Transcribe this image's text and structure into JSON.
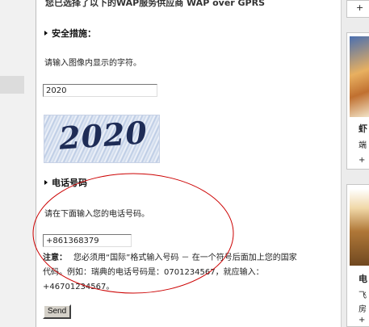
{
  "top_notice": "您已选择了以下的WAP服务供应商 WAP over GPRS",
  "security": {
    "title": "安全措施：",
    "instruction": "请输入图像内显示的字符。",
    "input_value": "2020",
    "captcha_text": "2020"
  },
  "phone": {
    "title": "电话号码",
    "instruction": "请在下面输入您的电话号码。",
    "input_value": "+861368379",
    "note_label": "注意：",
    "note_line1": "您必须用“国际”格式输入号码 － 在一个符号后面加上您的国家",
    "note_line2": "代码。例如：瑞典的电话号码是：0701234567，就应输入：",
    "note_line3": "+46701234567。"
  },
  "send_button": "Send",
  "right_sidebar": {
    "top_glyph": "+",
    "item_glyphs": [
      "虾",
      "端",
      "+",
      "电",
      "飞",
      "房",
      "+"
    ]
  },
  "colors": {
    "annotation_ellipse": "#cc0000",
    "captcha_text": "#1e2c56"
  }
}
